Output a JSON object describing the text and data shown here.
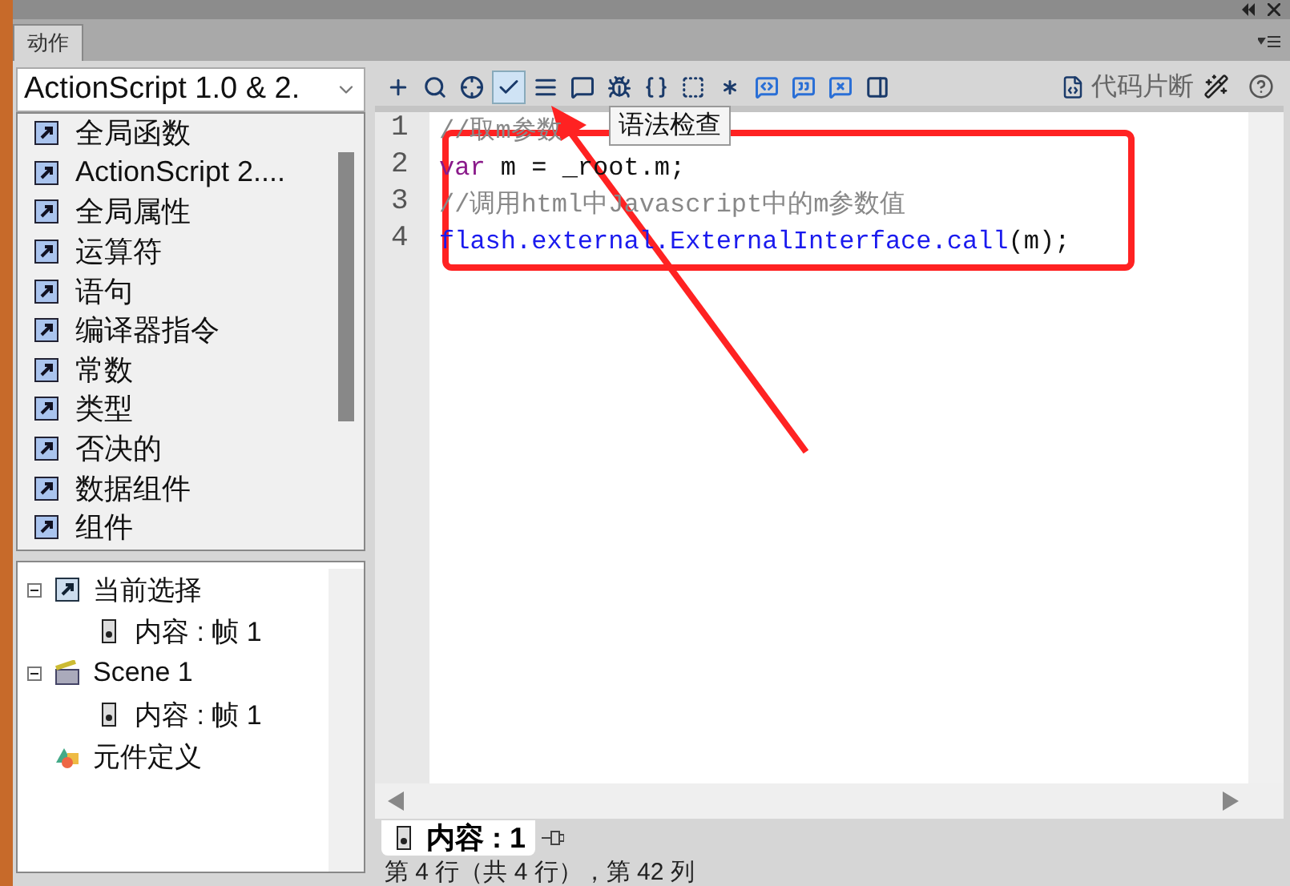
{
  "panel": {
    "tab": {
      "label": "动作",
      "selected": true
    }
  },
  "toolbox": {
    "dropdown": {
      "value": "ActionScript 1.0 & 2."
    },
    "items": [
      {
        "label": "全局函数"
      },
      {
        "label": "ActionScript 2...."
      },
      {
        "label": "全局属性"
      },
      {
        "label": "运算符"
      },
      {
        "label": "语句"
      },
      {
        "label": "编译器指令"
      },
      {
        "label": "常数"
      },
      {
        "label": "类型"
      },
      {
        "label": "否决的"
      },
      {
        "label": "数据组件"
      },
      {
        "label": "组件"
      }
    ]
  },
  "script_tree": [
    {
      "label": "当前选择",
      "kind": "selection",
      "expanded": true,
      "children": [
        {
          "label": "内容 : 帧 1",
          "kind": "frame"
        }
      ]
    },
    {
      "label": "Scene 1",
      "kind": "scene",
      "expanded": true,
      "children": [
        {
          "label": "内容 : 帧 1",
          "kind": "frame"
        }
      ]
    },
    {
      "label": "元件定义",
      "kind": "symbols"
    }
  ],
  "toolbar": {
    "buttons": [
      {
        "selected": false
      },
      {
        "selected": false
      },
      {
        "selected": false
      },
      {
        "selected": true
      },
      {
        "selected": false
      },
      {
        "selected": false
      },
      {
        "selected": false
      },
      {
        "selected": false
      },
      {
        "selected": false
      },
      {
        "selected": false
      },
      {
        "selected": false
      },
      {
        "selected": false
      },
      {
        "selected": false
      },
      {
        "selected": false
      }
    ],
    "snippets_label": "代码片断"
  },
  "tooltip": "语法检查",
  "code": {
    "lines": [
      {
        "number": "1",
        "tokens": [
          {
            "text": "//取m参数",
            "kind": "comment"
          }
        ]
      },
      {
        "number": "2",
        "tokens": [
          {
            "text": "var",
            "kind": "keyword"
          },
          {
            "text": " m = _root.m;",
            "kind": "plain"
          }
        ]
      },
      {
        "number": "3",
        "tokens": [
          {
            "text": "//调用html中Javascript中的m参数值",
            "kind": "comment"
          }
        ]
      },
      {
        "number": "4",
        "tokens": [
          {
            "text": "flash.external.ExternalInterface.call",
            "kind": "builtin"
          },
          {
            "text": "(m);",
            "kind": "plain"
          }
        ]
      }
    ]
  },
  "script_tab": {
    "label": "内容 : 1",
    "selected": true
  },
  "status_bar": "第 4 行（共 4 行），第 42 列"
}
